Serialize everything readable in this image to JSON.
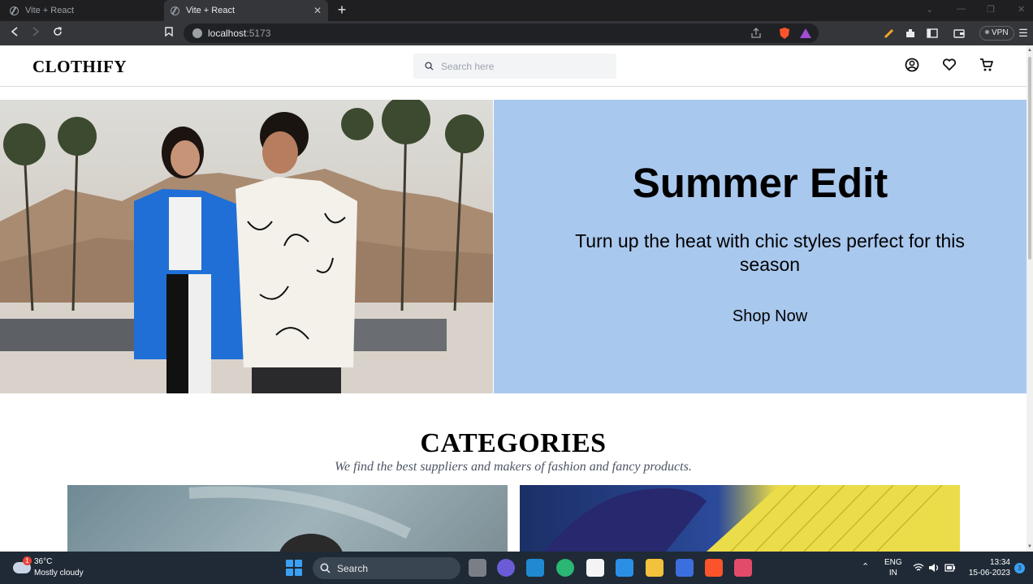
{
  "browser": {
    "tabs": [
      {
        "title": "Vite + React",
        "active": false
      },
      {
        "title": "Vite + React",
        "active": true
      }
    ],
    "new_tab_icon": "plus-icon",
    "url_host": "localhost",
    "url_port": ":5173",
    "vpn_label": "VPN"
  },
  "site": {
    "logo": "CLOTHIFY",
    "search": {
      "placeholder": "Search here",
      "value": ""
    },
    "header_icons": [
      "account-icon",
      "wishlist-icon",
      "cart-icon"
    ],
    "hero": {
      "title": "Summer Edit",
      "subtitle": "Turn up the heat with chic styles perfect for this season",
      "cta": "Shop Now",
      "panel_color": "#a9c8ee"
    },
    "categories": {
      "title": "CATEGORIES",
      "subtitle": "We find the best suppliers and makers of fashion and fancy products."
    }
  },
  "taskbar": {
    "weather": {
      "temp": "36°C",
      "condition": "Mostly cloudy",
      "badge": "1"
    },
    "search_label": "Search",
    "lang": {
      "line1": "ENG",
      "line2": "IN"
    },
    "time": "13:34",
    "date": "15-06-2023",
    "notifications": "3"
  }
}
